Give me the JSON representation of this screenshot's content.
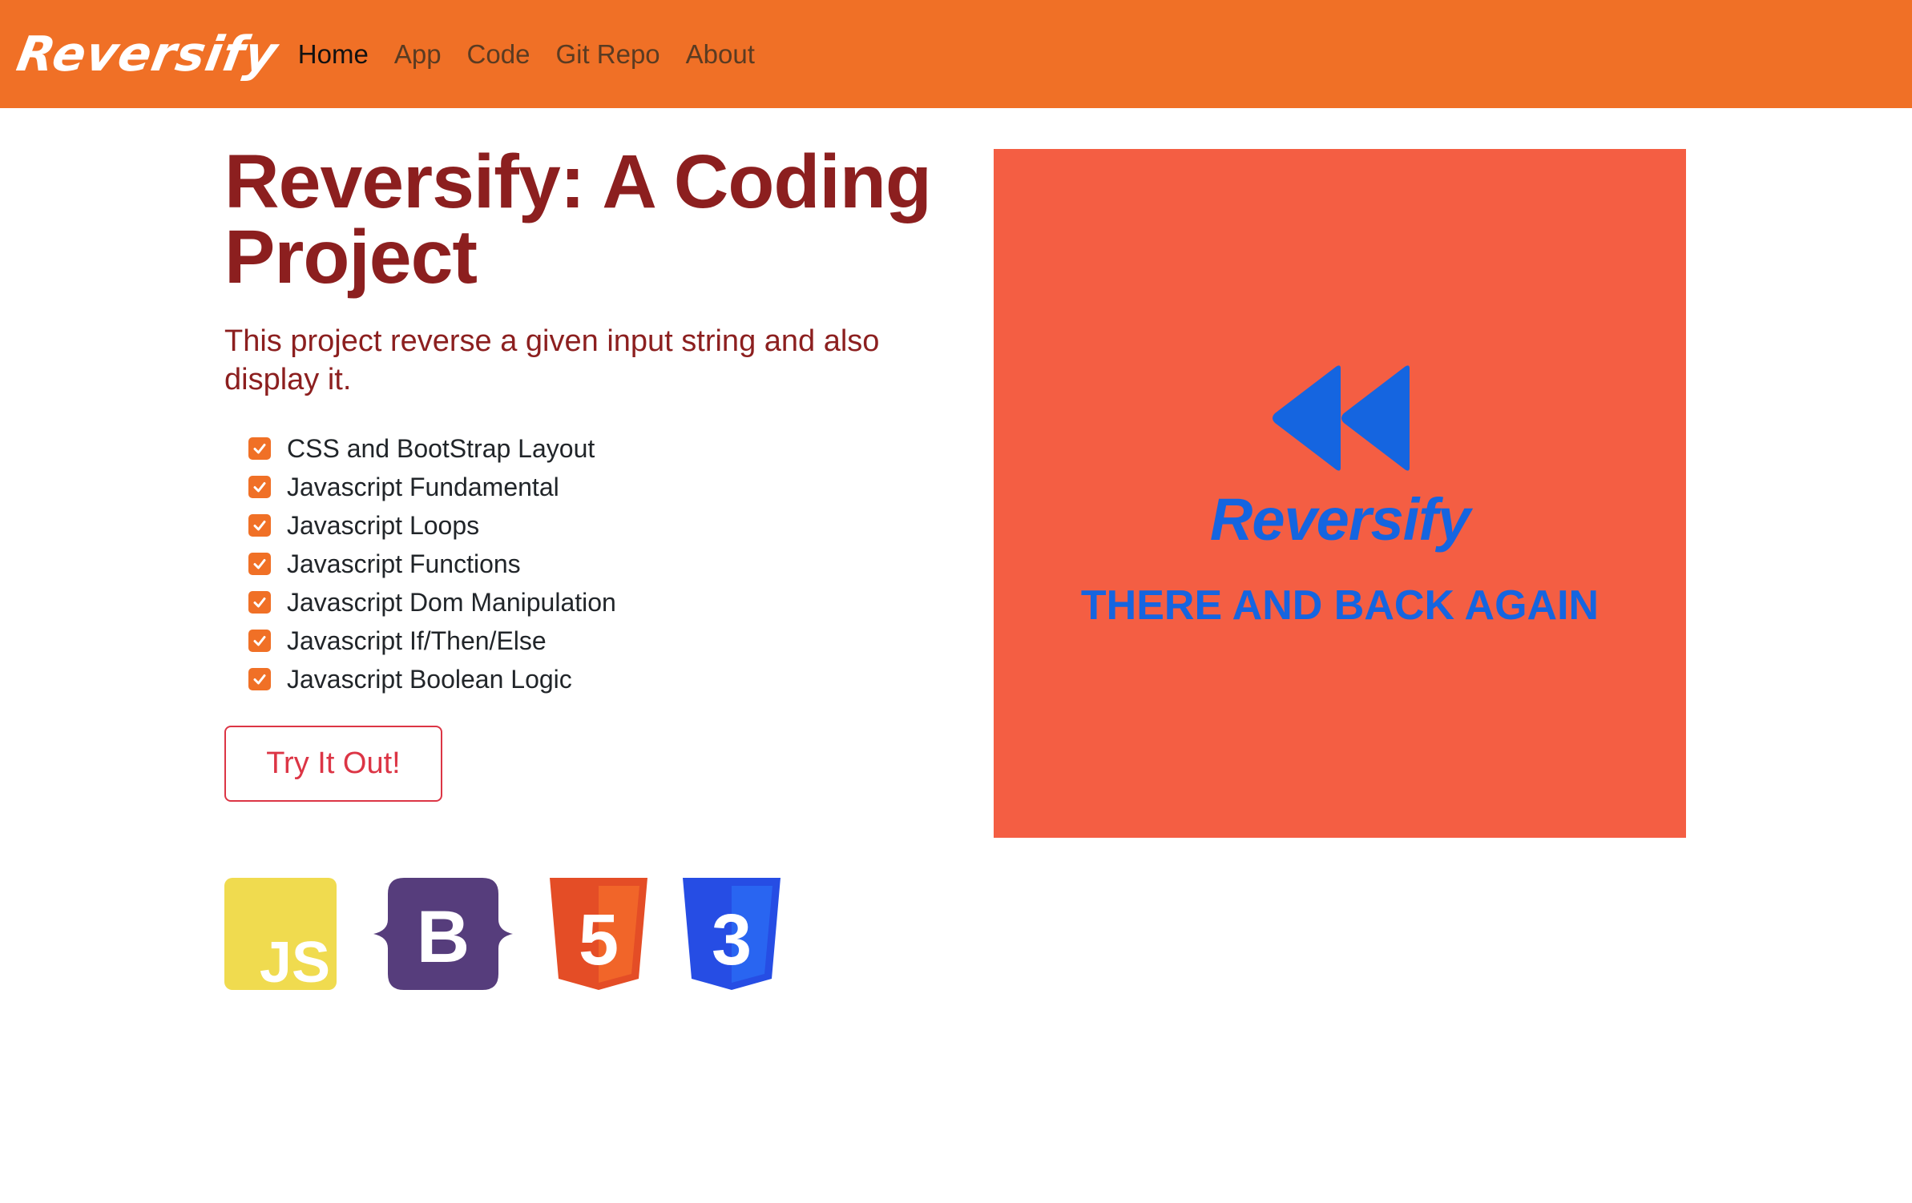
{
  "navbar": {
    "brand": "Reversify",
    "links": [
      {
        "label": "Home"
      },
      {
        "label": "App"
      },
      {
        "label": "Code"
      },
      {
        "label": "Git Repo"
      },
      {
        "label": "About"
      }
    ],
    "active_link": "Home",
    "background_color": "#f07026"
  },
  "hero": {
    "title": "Reversify: A Coding Project",
    "lead": "This project reverse a given input string and also display it.",
    "features": [
      "CSS and BootStrap Layout",
      "Javascript Fundamental",
      "Javascript Loops",
      "Javascript Functions",
      "Javascript Dom Manipulation",
      "Javascript If/Then/Else",
      "Javascript Boolean Logic"
    ],
    "cta_label": "Try It Out!",
    "title_color": "#8c1f1f",
    "check_color": "#f07026",
    "cta_color": "#dc3545"
  },
  "hero_image": {
    "title": "Reversify",
    "tagline": "THERE AND BACK AGAIN",
    "icon": "rewind-icon",
    "background_color": "#f45e43",
    "text_color": "#1565e0"
  },
  "tech_logos": [
    {
      "icon": "javascript-icon",
      "text": "JS"
    },
    {
      "icon": "bootstrap-icon",
      "text": "B"
    },
    {
      "icon": "html5-icon",
      "text": "5"
    },
    {
      "icon": "css3-icon",
      "text": "3"
    }
  ]
}
